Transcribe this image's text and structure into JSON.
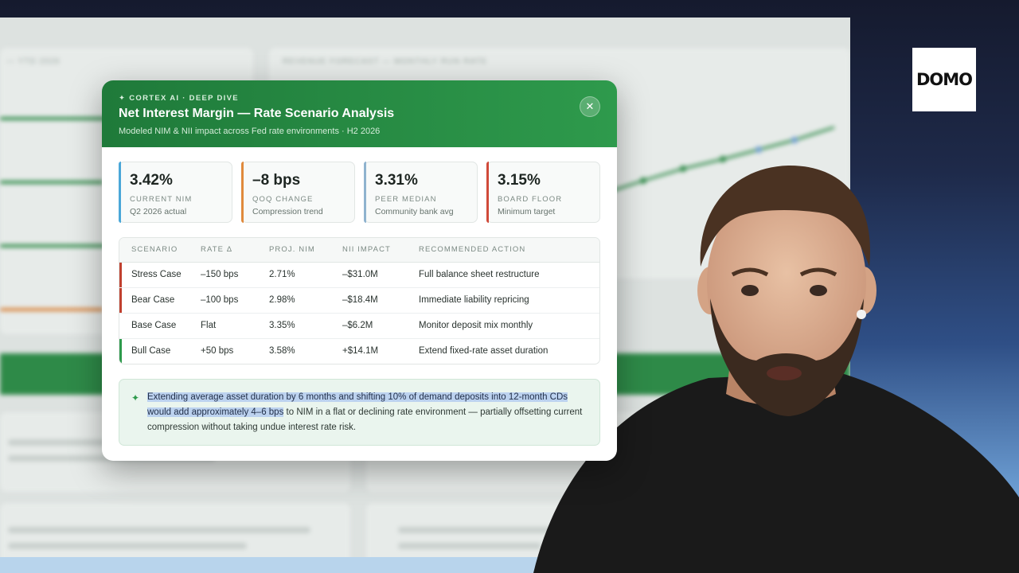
{
  "brand": {
    "logo_text": "DOMO"
  },
  "modal": {
    "eyebrow": "CORTEX AI · DEEP DIVE",
    "title": "Net Interest Margin — Rate Scenario Analysis",
    "subtitle": "Modeled NIM & NII impact across Fed rate environments · H2 2026",
    "close_glyph": "✕",
    "colors": {
      "header_start": "#1f7a3a",
      "header_end": "#2e9a4c"
    }
  },
  "kpis": [
    {
      "value": "3.42%",
      "label": "CURRENT NIM",
      "sub": "Q2 2026 actual",
      "accent": "#4aa7d8"
    },
    {
      "value": "–8 bps",
      "label": "QOQ CHANGE",
      "sub": "Compression trend",
      "accent": "#e08a3c"
    },
    {
      "value": "3.31%",
      "label": "PEER MEDIAN",
      "sub": "Community bank avg",
      "accent": "#8fb3cf"
    },
    {
      "value": "3.15%",
      "label": "BOARD FLOOR",
      "sub": "Minimum target",
      "accent": "#d04a3a"
    }
  ],
  "table": {
    "headers": [
      "SCENARIO",
      "RATE Δ",
      "PROJ. NIM",
      "NII IMPACT",
      "RECOMMENDED ACTION"
    ],
    "rows": [
      {
        "scenario": "Stress Case",
        "rate": "–150 bps",
        "nim": "2.71%",
        "impact": "–$31.0M",
        "action": "Full balance sheet restructure",
        "accent": "#c0402f"
      },
      {
        "scenario": "Bear Case",
        "rate": "–100 bps",
        "nim": "2.98%",
        "impact": "–$18.4M",
        "action": "Immediate liability repricing",
        "accent": "#c0402f"
      },
      {
        "scenario": "Base Case",
        "rate": "Flat",
        "nim": "3.35%",
        "impact": "–$6.2M",
        "action": "Monitor deposit mix monthly",
        "accent": ""
      },
      {
        "scenario": "Bull Case",
        "rate": "+50 bps",
        "nim": "3.58%",
        "impact": "+$14.1M",
        "action": "Extend fixed-rate asset duration",
        "accent": "#2e9a4c"
      }
    ]
  },
  "insight": {
    "highlighted": "Extending average asset duration by 6 months and shifting 10% of demand deposits into 12-month CDs would add approximately 4–6 bps",
    "rest": " to NIM in a flat or declining rate environment — partially offsetting current compression without taking undue interest rate risk."
  }
}
